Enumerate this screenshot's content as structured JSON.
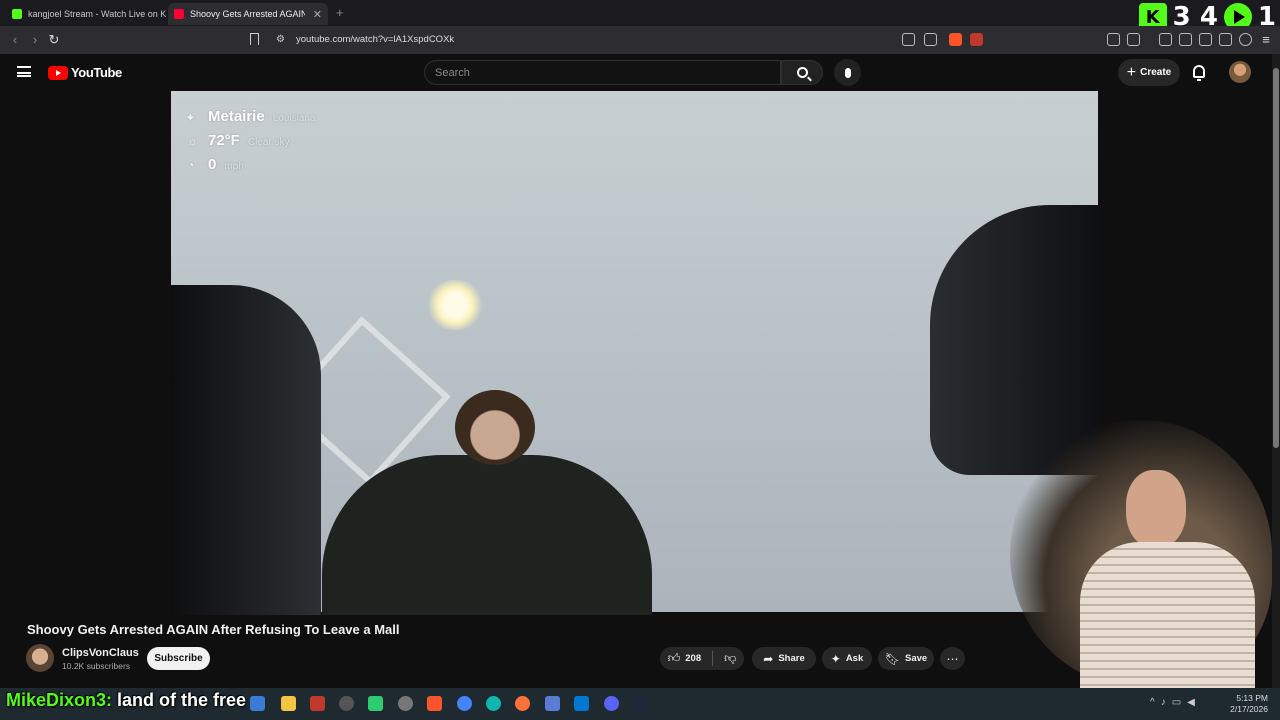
{
  "browser": {
    "tabs": [
      {
        "title": "kangjoel Stream - Watch Live on Kick",
        "active": false,
        "favicon_color": "#53fc18"
      },
      {
        "title": "Shoovy Gets Arrested AGAIN",
        "active": true,
        "favicon_color": "#ff0033"
      }
    ],
    "new_tab_glyph": "+",
    "url": "youtube.com/watch?v=lA1XspdCOXk"
  },
  "overlay_counter": {
    "left_number": "3 4",
    "right_number": "1"
  },
  "youtube": {
    "logo_text": "YouTube",
    "search_placeholder": "Search",
    "create_label": "Create"
  },
  "video": {
    "weather": {
      "city": "Metairie",
      "region": "Louisiana",
      "temperature": "72°F",
      "condition": "Clear sky",
      "wind_speed": "0",
      "wind_unit": "mph"
    },
    "title": "Shoovy Gets Arrested AGAIN After Refusing To Leave a Mall",
    "channel": {
      "name": "ClipsVonClaus",
      "subscribers": "10.2K subscribers"
    },
    "subscribe_label": "Subscribe",
    "like_count": "208",
    "share_label": "Share",
    "ask_label": "Ask",
    "save_label": "Save"
  },
  "chat": {
    "username": "MikeDixon3:",
    "message": "land of the free"
  },
  "system": {
    "time": "5:13 PM",
    "date": "2/17/2026"
  },
  "colors": {
    "kick_green": "#53fc18",
    "youtube_red": "#ff0000",
    "background": "#0f0f0f"
  }
}
